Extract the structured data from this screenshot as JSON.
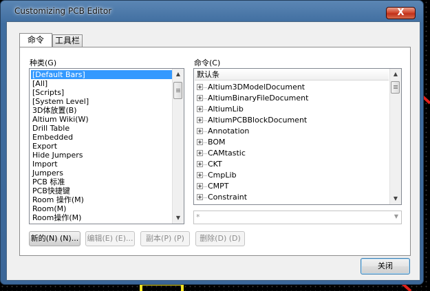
{
  "window": {
    "title": "Customizing PCB Editor",
    "close_glyph": "X"
  },
  "tabs": [
    {
      "label": "命令"
    },
    {
      "label": "工具栏"
    }
  ],
  "categories": {
    "label": "种类(G)",
    "shortcut": "(G)",
    "items": [
      "[Default Bars]",
      "[All]",
      "[Scripts]",
      "[System Level]",
      "3D体放置(B)",
      "Altium Wiki(W)",
      "Drill Table",
      "Embedded",
      "Export",
      "Hide Jumpers",
      "Import",
      "Jumpers",
      "PCB 标准",
      "PCB快捷键",
      "Room 操作(M)",
      "Room(M)",
      "Room操作(M)"
    ],
    "selected_index": 0
  },
  "commands": {
    "label": "命令(C)",
    "shortcut": "(C)",
    "header": "默认条",
    "items": [
      "Altium3DModelDocument",
      "AltiumBinaryFileDocument",
      "AltiumLib",
      "AltiumPCBBlockDocument",
      "Annotation",
      "BOM",
      "CAMtastic",
      "CKT",
      "CmpLib",
      "CMPT",
      "Constraint"
    ]
  },
  "filter": {
    "value": "*"
  },
  "buttons": {
    "new": "新的(N) (N)...",
    "edit": "编辑(E) (E)...",
    "copy": "副本(P) (P)",
    "delete": "删除(D) (D)",
    "close": "关闭"
  },
  "colors": {
    "selection": "#3399ff",
    "accent": "#3b6697",
    "trace_red": "#e0201a",
    "trace_yellow": "#f0e020"
  }
}
